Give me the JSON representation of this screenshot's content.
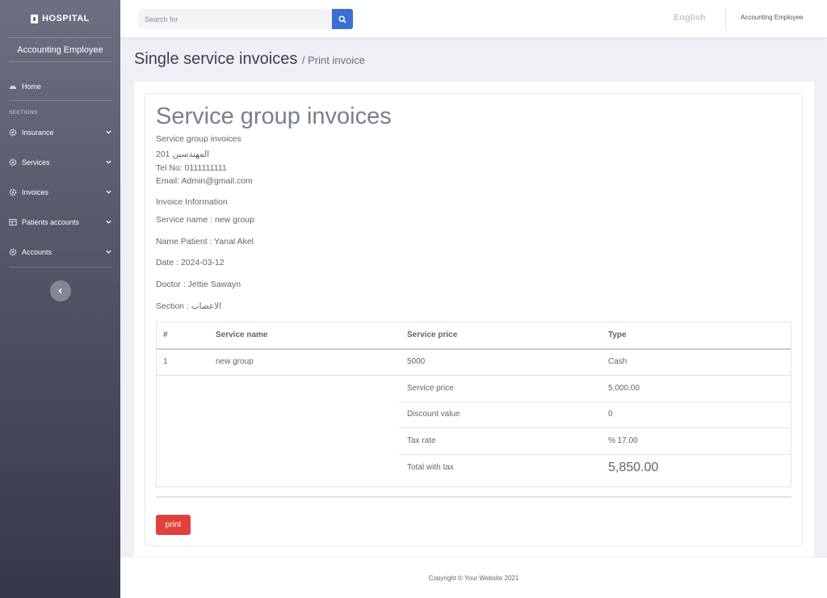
{
  "sidebar": {
    "brand": "HOSPITAL",
    "user": "Accounting Employee",
    "home": "Home",
    "section_label": "SECTIONS",
    "items": [
      {
        "label": "Insurance",
        "icon": "gear-icon"
      },
      {
        "label": "Services",
        "icon": "gear-icon"
      },
      {
        "label": "Invoices",
        "icon": "gear-icon"
      },
      {
        "label": "Patients accounts",
        "icon": "table-icon"
      },
      {
        "label": "Accounts",
        "icon": "gear-icon"
      }
    ]
  },
  "topbar": {
    "search_placeholder": "Search for",
    "language": "English",
    "user": "Accounting Employee"
  },
  "page": {
    "title": "Single service invoices",
    "breadcrumb": "/ Print invoice"
  },
  "invoice": {
    "title": "Service group invoices",
    "subtitle": "Service group invoices",
    "address": "201 المهندسين",
    "tel": "Tel No: 0111111111",
    "email": "Email: Admin@gmail.com",
    "info_heading": "Invoice Information",
    "service_name": "Service name : new group",
    "patient": "Name Patient : Yanal Akel",
    "date": "Date : 2024-03-12",
    "doctor": "Doctor : Jettie Sawayn",
    "section": "Section : الاعصاب"
  },
  "table": {
    "headers": [
      "#",
      "Service name",
      "Service price",
      "Type"
    ],
    "row": [
      "1",
      "new group",
      "5000",
      "Cash"
    ],
    "summary": [
      {
        "label": "Service price",
        "value": "5,000.00"
      },
      {
        "label": "Discount value",
        "value": "0"
      },
      {
        "label": "Tax rate",
        "value": "% 17.00"
      },
      {
        "label": "Total with tax",
        "value": "5,850.00"
      }
    ]
  },
  "print_label": "print",
  "footer": "Copyright © Your Website 2021",
  "colors": {
    "accent": "#3b6fd4",
    "print": "#e2413b"
  }
}
